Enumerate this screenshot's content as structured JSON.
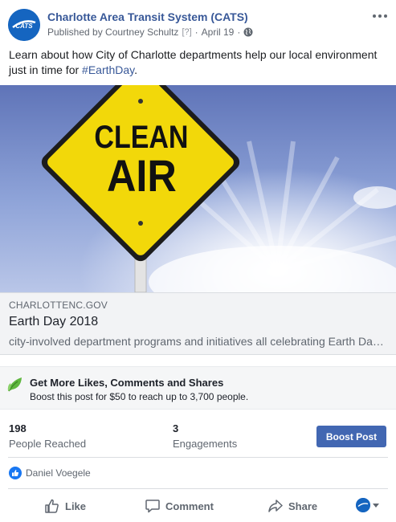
{
  "header": {
    "page_name": "Charlotte Area Transit System (CATS)",
    "published_by": "Published by Courtney Schultz",
    "help_marker": "[?]",
    "separator": "·",
    "date": "April 19",
    "separator2": "·",
    "avatar_text": "CATS"
  },
  "post": {
    "text": "Learn about how City of Charlotte departments help our local environment just in time for ",
    "hashtag": "#EarthDay",
    "text_end": "."
  },
  "preview": {
    "sign_line1": "CLEAN",
    "sign_line2": "AIR",
    "domain": "CHARLOTTENC.GOV",
    "title": "Earth Day 2018",
    "description": "city-involved department programs and initiatives all celebrating Earth Day and the promotion of a healthy environment"
  },
  "boost_promo": {
    "title": "Get More Likes, Comments and Shares",
    "subtitle": "Boost this post for $50 to reach up to 3,700 people."
  },
  "stats": {
    "reached_value": "198",
    "reached_label": "People Reached",
    "engagements_value": "3",
    "engagements_label": "Engagements",
    "boost_button": "Boost Post"
  },
  "reactions": {
    "liked_by": "Daniel Voegele"
  },
  "actions": {
    "like": "Like",
    "comment": "Comment",
    "share": "Share"
  },
  "colors": {
    "link_blue": "#385898",
    "boost_button": "#4267b2",
    "sign_yellow": "#f2d80a",
    "sky": "#8aa0d6"
  }
}
